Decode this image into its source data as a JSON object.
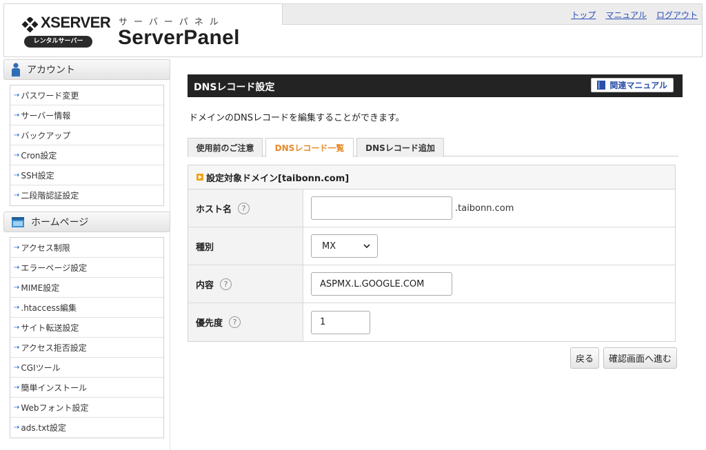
{
  "header": {
    "brand": "XSERVER",
    "badge": "レンタルサーバー",
    "panel_kana": "サーバーパネル",
    "panel_title": "ServerPanel",
    "nav": [
      "トップ",
      "マニュアル",
      "ログアウト"
    ]
  },
  "sidebar": {
    "account": {
      "title": "アカウント",
      "items": [
        "パスワード変更",
        "サーバー情報",
        "バックアップ",
        "Cron設定",
        "SSH設定",
        "二段階認証設定"
      ]
    },
    "homepage": {
      "title": "ホームページ",
      "items": [
        "アクセス制限",
        "エラーページ設定",
        "MIME設定",
        ".htaccess編集",
        "サイト転送設定",
        "アクセス拒否設定",
        "CGIツール",
        "簡単インストール",
        "Webフォント設定",
        "ads.txt設定"
      ]
    }
  },
  "main": {
    "title": "DNSレコード設定",
    "manual_label": "関連マニュアル",
    "description": "ドメインのDNSレコードを編集することができます。",
    "tabs": [
      "使用前のご注意",
      "DNSレコード一覧",
      "DNSレコード追加"
    ],
    "active_tab": "DNSレコード一覧",
    "form": {
      "heading": "設定対象ドメイン[taibonn.com]",
      "host_label": "ホスト名",
      "host_value": "",
      "host_suffix": ".taibonn.com",
      "type_label": "種別",
      "type_value": "MX",
      "content_label": "内容",
      "content_value": "ASPMX.L.GOOGLE.COM",
      "priority_label": "優先度",
      "priority_value": "1",
      "help_glyph": "?"
    },
    "back_button": "戻る",
    "confirm_button": "確認画面へ進む"
  },
  "colors": {
    "title_bar": "#232323",
    "active_tab": "#e8892b",
    "link": "#2a4db8",
    "accent_square": "#f0a31a"
  }
}
